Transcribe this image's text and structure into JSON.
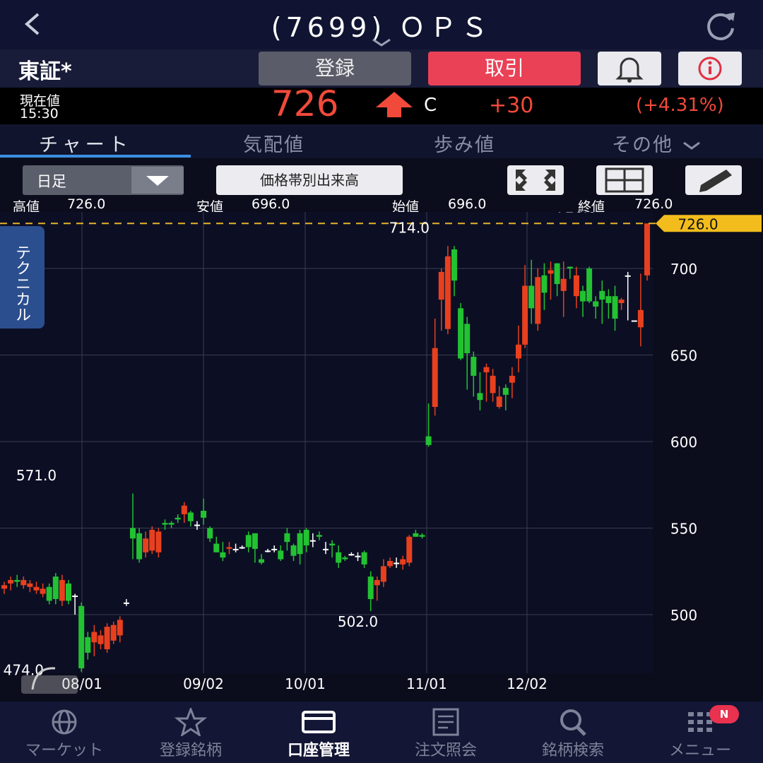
{
  "header": {
    "back_icon": "chevron-left-icon",
    "title": "(7699) ＯＰＳ",
    "refresh_icon": "refresh-icon"
  },
  "toolbar": {
    "market": "東証*",
    "register_label": "登録",
    "trade_label": "取引",
    "bell_icon": "bell-icon",
    "info_icon": "info-icon",
    "trade_color": "#ea4156"
  },
  "price": {
    "label": "現在値",
    "time": "15:30",
    "value": "726",
    "direction": "up",
    "flag": "C",
    "change": "+30",
    "change_pct": "(+4.31%)",
    "up_color": "#f24a3a"
  },
  "tabs": [
    "チャート",
    "気配値",
    "歩み値",
    "その他"
  ],
  "active_tab": "チャート",
  "controls": {
    "period": "日足",
    "volume_label": "価格帯別出来高",
    "icons": [
      "expand-icon",
      "layout-grid-icon",
      "pencil-icon"
    ]
  },
  "ohlc": {
    "high_label": "高値",
    "high": "726.0",
    "low_label": "安値",
    "low": "696.0",
    "open_label": "始値",
    "open": "696.0",
    "close_label": "終値",
    "close": "726.0"
  },
  "technical_tab": "テクニカル",
  "chart_data": {
    "type": "candlestick",
    "y_ticks": [
      "700",
      "650",
      "600",
      "550",
      "500"
    ],
    "ylim": [
      468,
      732
    ],
    "x_ticks": [
      "08/01",
      "09/02",
      "10/01",
      "11/01",
      "12/02"
    ],
    "current_price_label": "726.0",
    "annotations": [
      {
        "text": "571.0",
        "index": 5
      },
      {
        "text": "474.0",
        "index": 3
      },
      {
        "text": "502.0",
        "index": 55
      },
      {
        "text": "714.0",
        "index": 63
      },
      {
        "text": "726.0",
        "index": 89
      }
    ],
    "up_color": "#e8401e",
    "down_color": "#22c232",
    "candles": [
      [
        515,
        517,
        519,
        512
      ],
      [
        518,
        520,
        522,
        514
      ],
      [
        520,
        519,
        523,
        516
      ],
      [
        517,
        520,
        522,
        515
      ],
      [
        516,
        518,
        520,
        513
      ],
      [
        514,
        516,
        519,
        512
      ],
      [
        512,
        515,
        518,
        510
      ],
      [
        516,
        508,
        518,
        506
      ],
      [
        522,
        509,
        524,
        506
      ],
      [
        508,
        520,
        523,
        505
      ],
      [
        518,
        508,
        520,
        506
      ],
      [
        511,
        511,
        512,
        500
      ],
      [
        505,
        469,
        507,
        467
      ],
      [
        487,
        478,
        490,
        474
      ],
      [
        484,
        490,
        494,
        476
      ],
      [
        483,
        488,
        491,
        480
      ],
      [
        480,
        493,
        495,
        478
      ],
      [
        485,
        494,
        496,
        483
      ],
      [
        488,
        497,
        499,
        484
      ],
      [
        507,
        507,
        509,
        505
      ],
      [
        550,
        544,
        570,
        532
      ],
      [
        547,
        532,
        550,
        530
      ],
      [
        536,
        544,
        548,
        533
      ],
      [
        537,
        549,
        551,
        535
      ],
      [
        536,
        548,
        550,
        533
      ],
      [
        553,
        552,
        555,
        549
      ],
      [
        553,
        552,
        554,
        550
      ],
      [
        556,
        555,
        558,
        553
      ],
      [
        558,
        563,
        565,
        553
      ],
      [
        559,
        554,
        560,
        551
      ],
      [
        552,
        552,
        554,
        549
      ],
      [
        560,
        556,
        567,
        552
      ],
      [
        550,
        544,
        551,
        542
      ],
      [
        541,
        536,
        545,
        536
      ],
      [
        536,
        533,
        542,
        531
      ],
      [
        538,
        539,
        542,
        535
      ],
      [
        538,
        538,
        541,
        536
      ],
      [
        539,
        539,
        540,
        538
      ],
      [
        546,
        539,
        548,
        536
      ],
      [
        547,
        538,
        547,
        530
      ],
      [
        532,
        530,
        535,
        529
      ],
      [
        537,
        537,
        538,
        536
      ],
      [
        538,
        538,
        540,
        536
      ],
      [
        537,
        532,
        540,
        531
      ],
      [
        547,
        542,
        550,
        537
      ],
      [
        540,
        534,
        541,
        531
      ],
      [
        547,
        535,
        549,
        529
      ],
      [
        549,
        540,
        550,
        536
      ],
      [
        543,
        543,
        547,
        539
      ],
      [
        546,
        545,
        548,
        543
      ],
      [
        538,
        538,
        542,
        535
      ],
      [
        541,
        540,
        543,
        533
      ],
      [
        536,
        530,
        540,
        527
      ],
      [
        533,
        532,
        534,
        531
      ],
      [
        535,
        535,
        536,
        534
      ],
      [
        534,
        534,
        536,
        531
      ],
      [
        536,
        529,
        537,
        527
      ],
      [
        522,
        509,
        525,
        502
      ],
      [
        517,
        520,
        522,
        508
      ],
      [
        519,
        528,
        532,
        516
      ],
      [
        528,
        531,
        533,
        527
      ],
      [
        530,
        530,
        533,
        527
      ],
      [
        529,
        532,
        534,
        526
      ],
      [
        530,
        545,
        546,
        528
      ],
      [
        547,
        545,
        549,
        545
      ],
      [
        546,
        545,
        547,
        544
      ],
      [
        603,
        598,
        622,
        597
      ],
      [
        620,
        654,
        671,
        615
      ],
      [
        682,
        698,
        700,
        664
      ],
      [
        665,
        707,
        713,
        662
      ],
      [
        711,
        693,
        713,
        684
      ],
      [
        677,
        648,
        680,
        647
      ],
      [
        668,
        651,
        672,
        630
      ],
      [
        649,
        638,
        652,
        626
      ],
      [
        628,
        624,
        640,
        618
      ],
      [
        640,
        643,
        645,
        623
      ],
      [
        628,
        638,
        642,
        623
      ],
      [
        620,
        626,
        632,
        619
      ],
      [
        631,
        627,
        633,
        618
      ],
      [
        634,
        638,
        643,
        625
      ],
      [
        648,
        656,
        667,
        640
      ],
      [
        656,
        690,
        702,
        654
      ],
      [
        690,
        677,
        705,
        668
      ],
      [
        668,
        695,
        700,
        664
      ],
      [
        696,
        686,
        703,
        676
      ],
      [
        697,
        699,
        704,
        682
      ],
      [
        703,
        691,
        703,
        684
      ],
      [
        687,
        694,
        704,
        672
      ],
      [
        701,
        700,
        701,
        694
      ],
      [
        684,
        696,
        701,
        677
      ],
      [
        687,
        681,
        690,
        672
      ],
      [
        700,
        681,
        701,
        680
      ],
      [
        681,
        678,
        684,
        671
      ],
      [
        687,
        682,
        693,
        668
      ],
      [
        684,
        680,
        688,
        671
      ],
      [
        684,
        671,
        690,
        664
      ],
      [
        680,
        682,
        683,
        676
      ],
      [
        696,
        696,
        698,
        670
      ],
      [
        670,
        670,
        670,
        670
      ],
      [
        666,
        676,
        697,
        655
      ],
      [
        696,
        726,
        726,
        693
      ]
    ]
  },
  "nav": [
    {
      "label": "マーケット",
      "icon": "globe-icon"
    },
    {
      "label": "登録銘柄",
      "icon": "star-icon"
    },
    {
      "label": "口座管理",
      "icon": "wallet-icon"
    },
    {
      "label": "注文照会",
      "icon": "document-icon"
    },
    {
      "label": "銘柄検索",
      "icon": "search-icon"
    },
    {
      "label": "メニュー",
      "icon": "menu-grid-icon",
      "badge": "N"
    }
  ],
  "active_nav": "口座管理"
}
